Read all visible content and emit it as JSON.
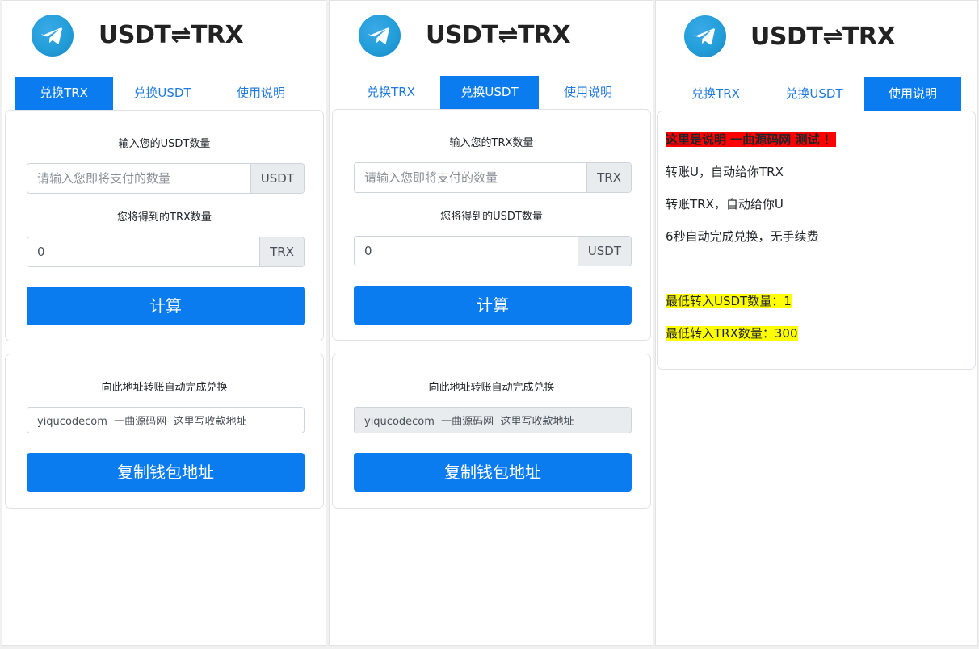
{
  "brand": {
    "title": "USDT⇌TRX"
  },
  "tabs": [
    "兑换TRX",
    "兑换USDT",
    "使用说明"
  ],
  "usdt_to_trx": {
    "input_label": "输入您的USDT数量",
    "input_placeholder": "请输入您即将支付的数量",
    "input_unit": "USDT",
    "output_label": "您将得到的TRX数量",
    "output_value": "0",
    "output_unit": "TRX",
    "calc_button": "计算"
  },
  "trx_to_usdt": {
    "input_label": "输入您的TRX数量",
    "input_placeholder": "请输入您即将支付的数量",
    "input_unit": "TRX",
    "output_label": "您将得到的USDT数量",
    "output_value": "0",
    "output_unit": "USDT",
    "calc_button": "计算"
  },
  "address_card": {
    "label": "向此地址转账自动完成兑换",
    "address": "yiqucodecom  一曲源码网  这里写收款地址",
    "copy_button": "复制钱包地址"
  },
  "instructions": {
    "title": "这里是说明  一曲源码网 测试 ！",
    "line1": "转账U，自动给你TRX",
    "line2": "转账TRX，自动给你U",
    "line3": "6秒自动完成兑换，无手续费",
    "min_usdt": "最低转入USDT数量：1",
    "min_trx": "最低转入TRX数量：300"
  },
  "colors": {
    "primary": "#0b7cf0",
    "tab_text": "#1f7ae0",
    "telegram": "#229ed9",
    "highlight_red": "#ff0000",
    "highlight_yellow": "#ffff00"
  },
  "icons": {
    "logo": "telegram-icon"
  }
}
